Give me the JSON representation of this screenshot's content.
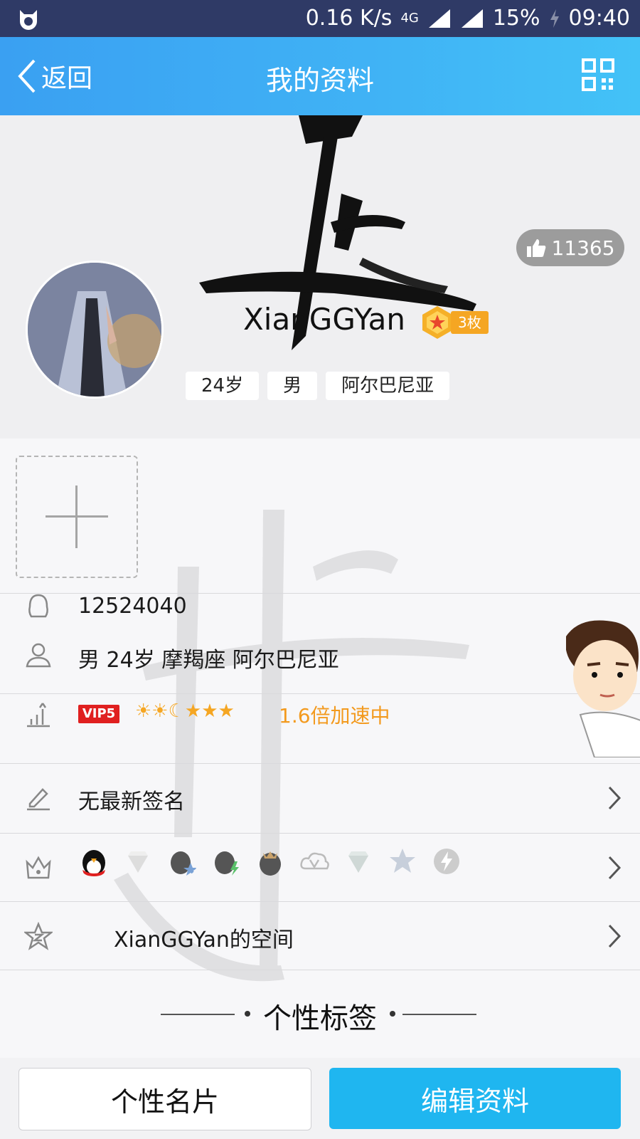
{
  "status_bar": {
    "speed": "0.16 K/s",
    "network": "4G",
    "battery": "15%",
    "time": "09:40"
  },
  "title_bar": {
    "back_label": "返回",
    "title": "我的资料"
  },
  "profile": {
    "likes": "11365",
    "username": "XianGGYan",
    "medal_count": "3枚",
    "tags": [
      "24岁",
      "男",
      "阿尔巴尼亚"
    ]
  },
  "info": {
    "qq_number": "12524040",
    "details": "男  24岁  摩羯座  阿尔巴尼亚",
    "vip_label": "VIP5",
    "level_icons": "☀☀☾★★★",
    "speed_text": "1.6倍加速中",
    "signature": "无最新签名",
    "space_label": "XianGGYan的空间"
  },
  "section": {
    "title": "个性标签"
  },
  "bottom": {
    "card_button": "个性名片",
    "edit_button": "编辑资料"
  },
  "colors": {
    "title_bar": "#3ba5f3",
    "accent_orange": "#f39a1e",
    "edit_button": "#1fb6f0"
  }
}
